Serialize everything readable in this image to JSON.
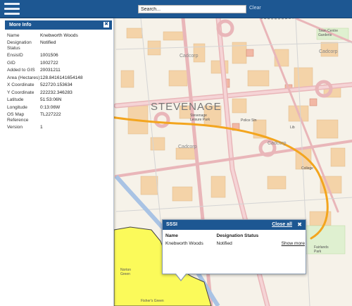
{
  "search": {
    "value": "Search...",
    "clear_label": "Clear"
  },
  "map": {
    "town_label": "STEVENAGE",
    "watermarks": [
      "Cadcorp",
      "Cadcorp",
      "Cadcorp",
      "Cadcorp"
    ],
    "small_labels": {
      "leisure": "Stevenage Leisure Park",
      "college": "College",
      "town_centre": "Town Centre Gardens",
      "police": "Police Stn",
      "library": "Lib",
      "nortons": "Norton Green",
      "pond": "Fisher's Green",
      "park": "Fairlands Park"
    }
  },
  "info_panel": {
    "title": "More Info",
    "rows": [
      {
        "key": "Name",
        "value": "Knebworth Woods"
      },
      {
        "key": "Designation Status",
        "value": "Notified"
      },
      {
        "key": "EnsisID",
        "value": "1001506"
      },
      {
        "key": "GID",
        "value": "1002722"
      },
      {
        "key": "Added to GIS",
        "value": "20031211"
      },
      {
        "key": "Area (Hectares)",
        "value": "128.8416141654148"
      },
      {
        "key": "X Coordinate",
        "value": "522720.153634"
      },
      {
        "key": "Y Coordinate",
        "value": "222232.346283"
      },
      {
        "key": "Latitude",
        "value": "51:53:06N"
      },
      {
        "key": "Longitude",
        "value": "0:13:06W"
      },
      {
        "key": "OS Map Reference",
        "value": "TL227222"
      },
      {
        "key": "Version",
        "value": "1"
      }
    ]
  },
  "sssi_popup": {
    "title": "SSSI",
    "close_all_label": "Close all",
    "close_icon": "✖",
    "columns": [
      "Name",
      "Designation Status"
    ],
    "rows": [
      {
        "name": "Knebworth Woods",
        "status": "Notified",
        "action": "Show more"
      }
    ]
  },
  "colors": {
    "header_blue": "#1d5792",
    "arrow_orange": "#f3a51e",
    "sssi_yellow": "#fbfa5a",
    "road_pink": "#e9b6b9",
    "water_blue": "#a9c3e4"
  }
}
